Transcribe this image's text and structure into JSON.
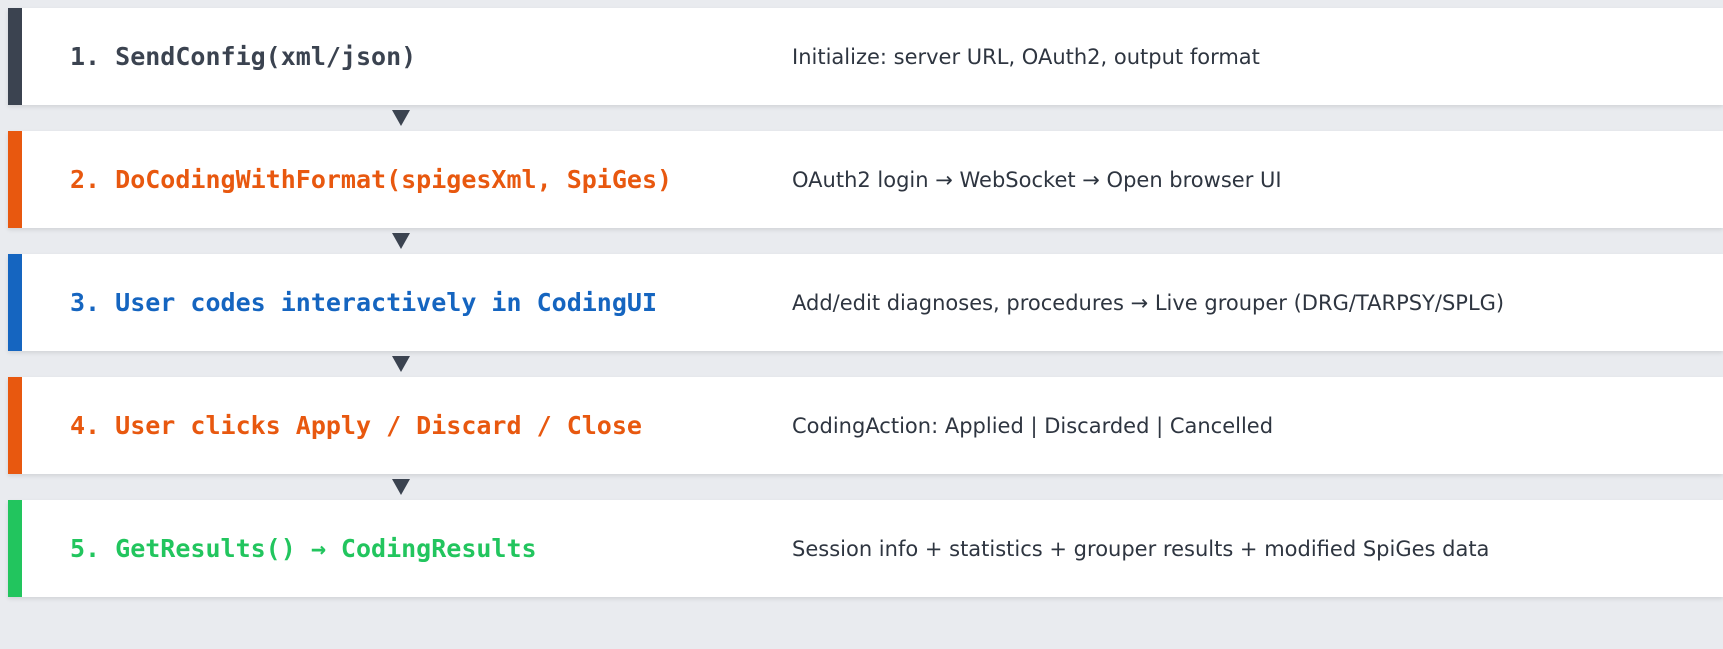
{
  "colors": {
    "slate": "#3b4350",
    "orange": "#e8580f",
    "blue": "#1565c0",
    "green": "#22c55e",
    "background": "#e9ebef"
  },
  "steps": [
    {
      "title": "1. SendConfig(xml/json)",
      "description": "Initialize: server URL, OAuth2, output format",
      "color": "slate"
    },
    {
      "title": "2. DoCodingWithFormat(spigesXml, SpiGes)",
      "description": "OAuth2 login → WebSocket → Open browser UI",
      "color": "orange"
    },
    {
      "title": "3. User codes interactively in CodingUI",
      "description": "Add/edit diagnoses, procedures → Live grouper (DRG/TARPSY/SPLG)",
      "color": "blue"
    },
    {
      "title": "4. User clicks Apply / Discard / Close",
      "description": "CodingAction: Applied | Discarded | Cancelled",
      "color": "orange"
    },
    {
      "title": "5. GetResults() → CodingResults",
      "description": "Session info + statistics + grouper results + modified SpiGes data",
      "color": "green"
    }
  ],
  "connector_icon": "down-triangle-arrow-icon"
}
